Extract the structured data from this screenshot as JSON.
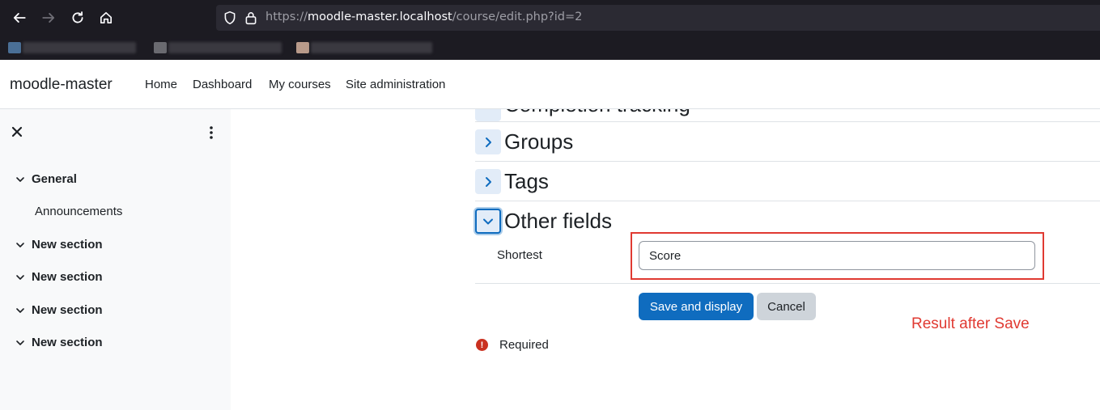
{
  "browser": {
    "url_scheme": "https://",
    "url_host": "moodle-master.localhost",
    "url_path": "/course/edit.php?id=2",
    "icons": [
      "back-arrow-icon",
      "forward-arrow-icon",
      "reload-icon",
      "home-icon",
      "shield-icon",
      "lock-icon"
    ]
  },
  "navbar": {
    "brand": "moodle-master",
    "links": [
      "Home",
      "Dashboard",
      "My courses",
      "Site administration"
    ]
  },
  "drawer": {
    "sections": [
      {
        "label": "General",
        "children": [
          "Announcements"
        ]
      },
      {
        "label": "New section"
      },
      {
        "label": "New section"
      },
      {
        "label": "New section"
      },
      {
        "label": "New section"
      }
    ]
  },
  "form": {
    "partial_heading": "Completion tracking",
    "fieldsets": [
      {
        "title": "Groups",
        "state": "collapsed"
      },
      {
        "title": "Tags",
        "state": "collapsed"
      },
      {
        "title": "Other fields",
        "state": "expanded"
      }
    ],
    "field_label": "Shortest",
    "field_value": "Score",
    "save_label": "Save and display",
    "cancel_label": "Cancel",
    "required_label": "Required"
  },
  "annotation": "Result after Save",
  "colors": {
    "primary": "#0f6cbf",
    "annotation_red": "#e03a32",
    "required_red": "#ca3120",
    "drawer_bg": "#f8f9fa",
    "browser_bg": "#1c1b22"
  }
}
